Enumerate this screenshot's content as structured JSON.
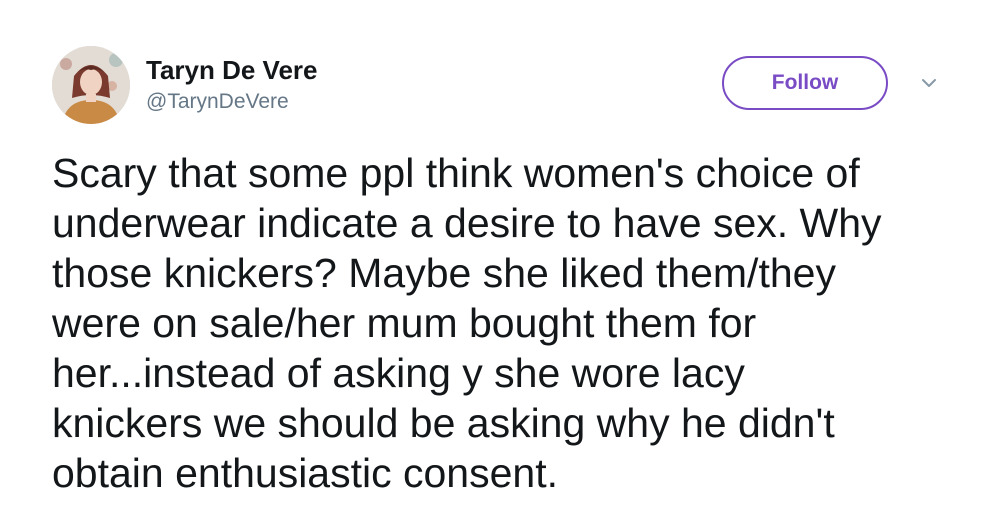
{
  "author": {
    "display_name": "Taryn De Vere",
    "handle": "@TarynDeVere"
  },
  "actions": {
    "follow_label": "Follow",
    "more_icon": "chevron-down-icon"
  },
  "tweet": {
    "text": "Scary that some ppl think women's choice of\nunderwear indicate a desire to have sex. Why\nthose knickers? Maybe she liked them/they\nwere on sale/her mum bought them for\nher...instead of asking y she wore lacy\nknickers we should be asking why he didn't\nobtain enthusiastic consent."
  },
  "colors": {
    "accent": "#794bc4",
    "text": "#14171a",
    "secondary_text": "#657786"
  }
}
